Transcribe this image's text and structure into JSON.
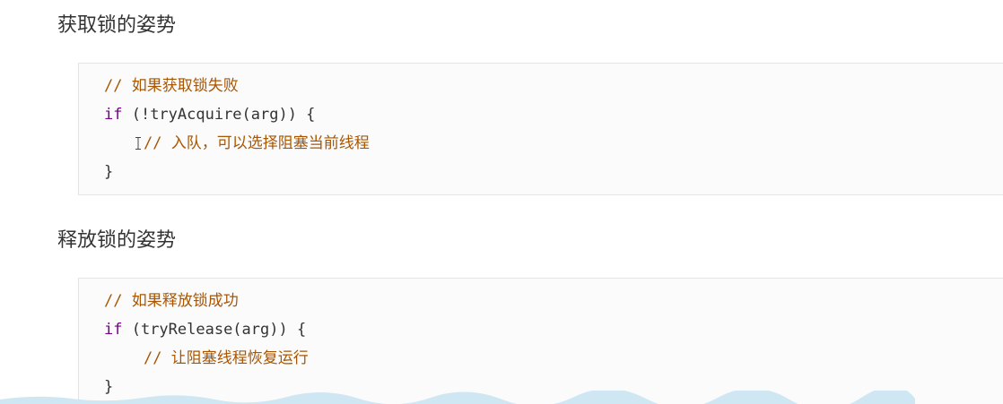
{
  "sections": [
    {
      "heading": "获取锁的姿势",
      "lines": {
        "comment1": "// 如果获取锁失败",
        "if_kw": "if",
        "cond": " (!tryAcquire(arg)) {",
        "comment2": "// 入队，可以选择阻塞当前线程",
        "close": "}"
      }
    },
    {
      "heading": "释放锁的姿势",
      "lines": {
        "comment1": "// 如果释放锁成功",
        "if_kw": "if",
        "cond": " (tryRelease(arg)) {",
        "comment2": "// 让阻塞线程恢复运行",
        "close": "}"
      }
    }
  ],
  "colors": {
    "comment": "#aa5500",
    "keyword": "#770088",
    "text": "#333333",
    "code_background": "#fbfbfb"
  },
  "icons": {
    "cursor": "text-cursor-icon"
  }
}
